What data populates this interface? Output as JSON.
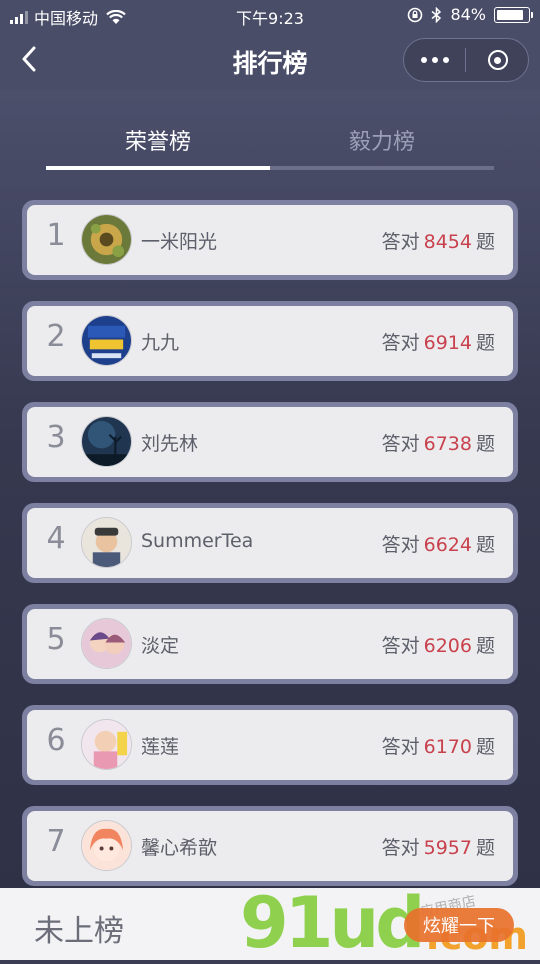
{
  "status_bar": {
    "carrier": "中国移动",
    "time": "下午9:23",
    "battery": "84%",
    "battery_level": 0.84
  },
  "nav": {
    "title": "排行榜"
  },
  "tabs": [
    {
      "label": "荣誉榜",
      "active": true
    },
    {
      "label": "毅力榜",
      "active": false
    }
  ],
  "rank_list": {
    "prefix": "答对",
    "suffix": "题",
    "items": [
      {
        "rank": "1",
        "name": "一米阳光",
        "score": "8454",
        "avatar": "sunflower-photo"
      },
      {
        "rank": "2",
        "name": "九九",
        "score": "6914",
        "avatar": "book-cover-photo"
      },
      {
        "rank": "3",
        "name": "刘先林",
        "score": "6738",
        "avatar": "night-tree-photo"
      },
      {
        "rank": "4",
        "name": "SummerTea",
        "score": "6624",
        "avatar": "child-photo"
      },
      {
        "rank": "5",
        "name": "淡定",
        "score": "6206",
        "avatar": "couple-photo"
      },
      {
        "rank": "6",
        "name": "莲莲",
        "score": "6170",
        "avatar": "baby-photo"
      },
      {
        "rank": "7",
        "name": "馨心希歆",
        "score": "5957",
        "avatar": "anime-girl-photo"
      }
    ]
  },
  "bottom_bar": {
    "my_rank": "未上榜",
    "show_button": "炫耀一下"
  },
  "watermark": {
    "brand": "91ud",
    "domain": ".com",
    "shop": "应用商店"
  },
  "colors": {
    "accent_score": "#c8414d",
    "button": "#e9712c",
    "background": "#3b3d55"
  }
}
